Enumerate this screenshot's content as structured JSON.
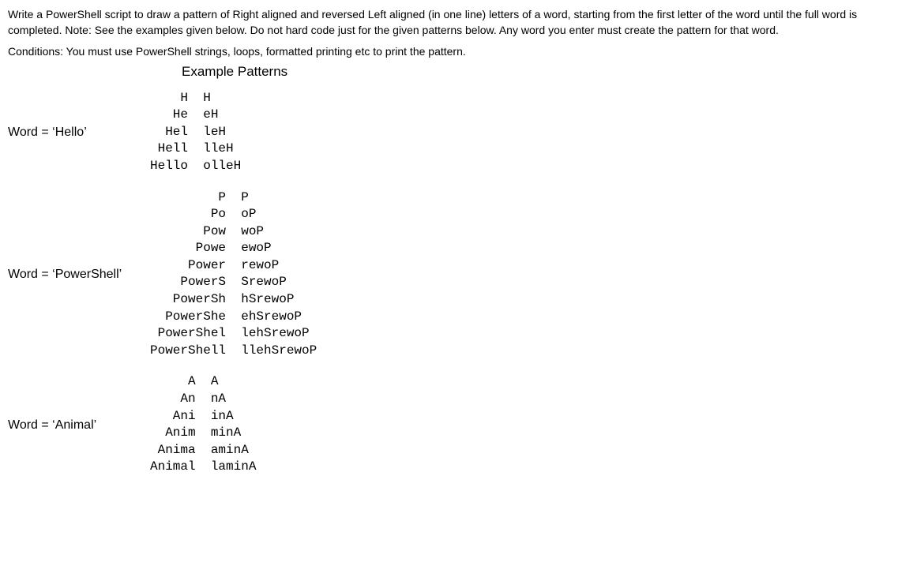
{
  "problem_text": "Write a PowerShell script to draw a pattern of Right aligned and reversed Left aligned (in one line) letters of a word, starting from the first letter of the word until the full word is completed. Note: See the examples given below. Do not hard code just for the given patterns below. Any word you enter must create the pattern for that word.",
  "conditions_text": "Conditions: You must use PowerShell strings, loops, formatted printing etc to print the pattern.",
  "example_heading": "Example Patterns",
  "examples": [
    {
      "label": "Word = ‘Hello’",
      "pattern": "    H  H\n   He  eH\n  Hel  leH\n Hell  lleH\nHello  olleH"
    },
    {
      "label": "Word = ‘PowerShell’",
      "pattern": "         P  P\n        Po  oP\n       Pow  woP\n      Powe  ewoP\n     Power  rewoP\n    PowerS  SrewoP\n   PowerSh  hSrewoP\n  PowerShe  ehSrewoP\n PowerShel  lehSrewoP\nPowerShell  llehSrewoP"
    },
    {
      "label": "Word = ‘Animal’",
      "pattern": "     A  A\n    An  nA\n   Ani  inA\n  Anim  minA\n Anima  aminA\nAnimal  laminA"
    }
  ]
}
